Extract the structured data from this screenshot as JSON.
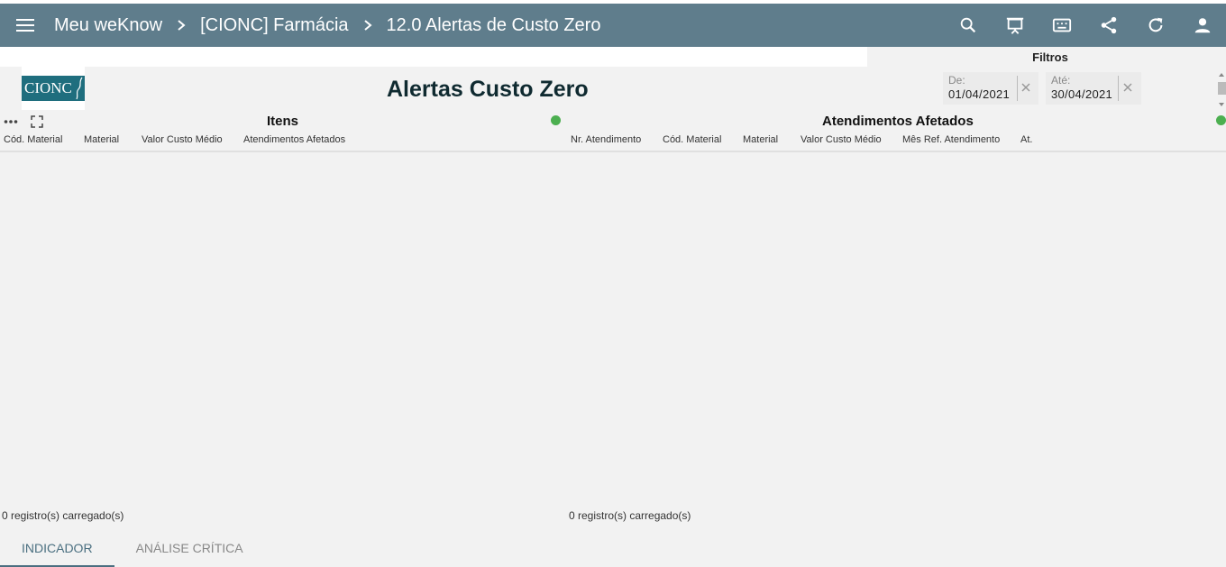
{
  "header": {
    "breadcrumb": [
      "Meu weKnow",
      "[CIONC] Farmácia",
      "12.0 Alertas de Custo Zero"
    ],
    "actions": [
      "search-icon",
      "presentation-icon",
      "keyboard-icon",
      "share-icon",
      "refresh-icon",
      "user-icon"
    ],
    "bg_color": "#5f7d8c"
  },
  "filters": {
    "title": "Filtros",
    "from": {
      "label": "De:",
      "value": "01/04/2021"
    },
    "to": {
      "label": "Até:",
      "value": "30/04/2021"
    }
  },
  "logo": {
    "text": "CIONC"
  },
  "page_title": "Alertas Custo Zero",
  "panels": {
    "itens": {
      "title": "Itens",
      "columns": [
        "Cód. Material",
        "Material",
        "Valor Custo Médio",
        "Atendimentos Afetados"
      ],
      "records": "0 registro(s) carregado(s)",
      "status_color": "#4caf50"
    },
    "atendimentos": {
      "title": "Atendimentos Afetados",
      "columns": [
        "Nr. Atendimento",
        "Cód. Material",
        "Material",
        "Valor Custo Médio",
        "Mês Ref. Atendimento",
        "At."
      ],
      "records": "0 registro(s) carregado(s)",
      "status_color": "#4caf50"
    }
  },
  "tabs": [
    {
      "label": "INDICADOR",
      "active": true
    },
    {
      "label": "ANÁLISE CRÍTICA",
      "active": false
    }
  ]
}
